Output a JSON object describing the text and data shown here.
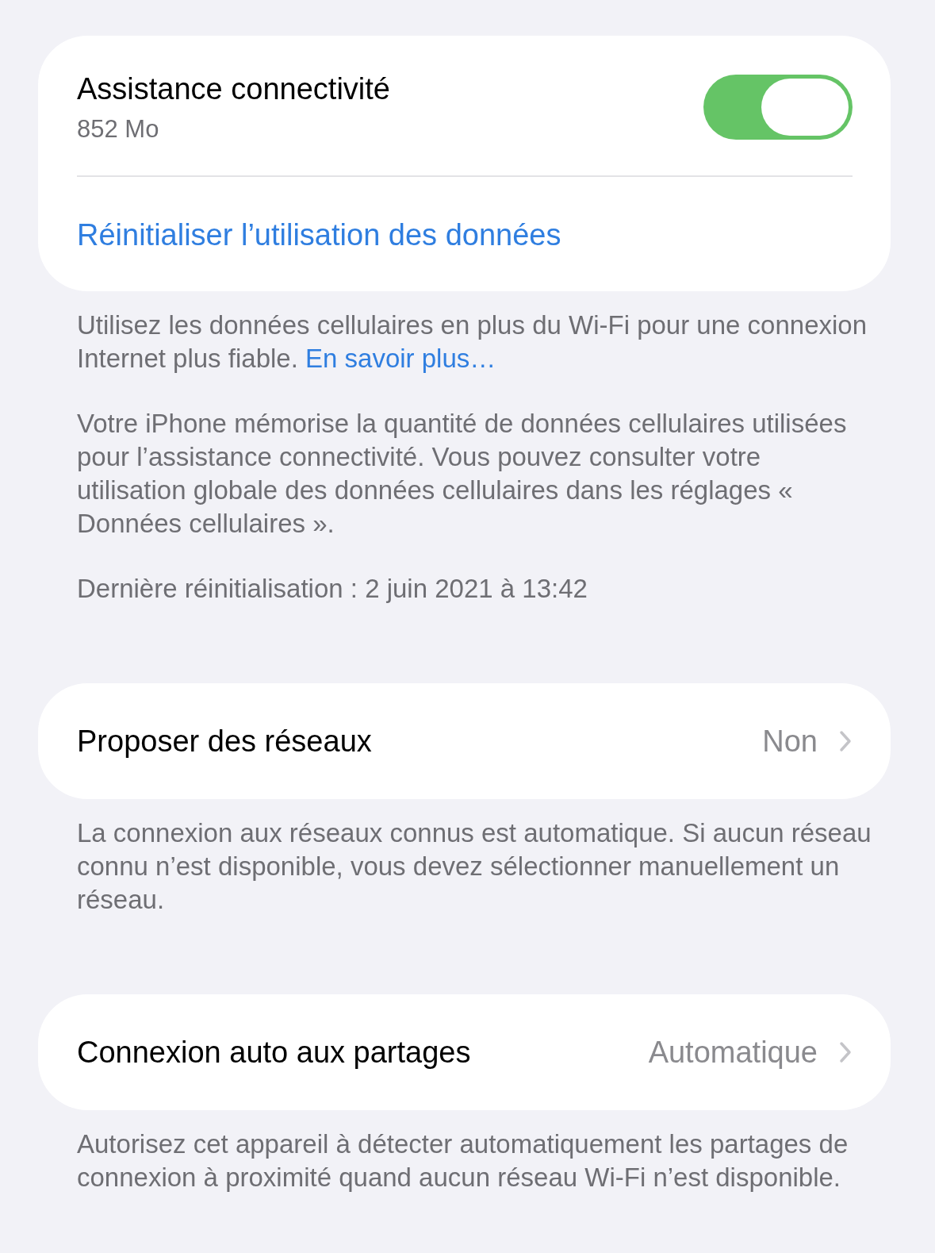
{
  "assist_card": {
    "title": "Assistance connectivité",
    "usage": "852 Mo",
    "on": true,
    "reset_link": "Réinitialiser l’utilisation des données"
  },
  "assist_footer": {
    "text": "Utilisez les données cellulaires en plus du Wi-Fi pour une connexion Internet plus fiable.",
    "link": "En savoir plus…",
    "notes": [
      "Votre iPhone mémorise la quantité de données cellulaires utilisées pour l’assistance connectivité. Vous pouvez consulter votre utilisation globale des données cellulaires dans les réglages « Données cellulaires ».",
      "Dernière réinitialisation : 2 juin 2021 à 13:42"
    ]
  },
  "nav_rows": [
    {
      "label": "Proposer des réseaux",
      "value": "Non",
      "footer": "La connexion aux réseaux connus est automatique. Si aucun réseau connu n’est disponible, vous devez sélectionner manuellement un réseau."
    },
    {
      "label": "Connexion auto aux partages",
      "value": "Automatique",
      "footer": "Autorisez cet appareil à détecter automatiquement les partages de connexion à proximité quand aucun réseau Wi-Fi n’est disponible."
    }
  ]
}
